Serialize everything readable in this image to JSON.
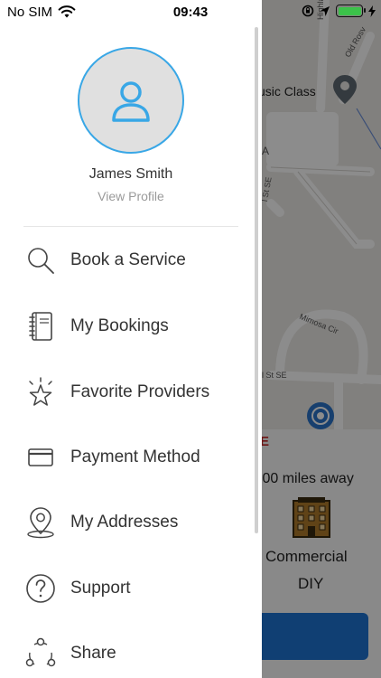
{
  "status_bar": {
    "carrier": "No SIM",
    "time": "09:43"
  },
  "profile": {
    "name": "James Smith",
    "link": "View Profile"
  },
  "menu": {
    "items": [
      {
        "label": "Book a Service",
        "icon": "search-icon"
      },
      {
        "label": "My Bookings",
        "icon": "notebook-icon"
      },
      {
        "label": "Favorite Providers",
        "icon": "star-icon"
      },
      {
        "label": "Payment Method",
        "icon": "card-icon"
      },
      {
        "label": "My Addresses",
        "icon": "location-pin-icon"
      },
      {
        "label": "Support",
        "icon": "question-icon"
      },
      {
        "label": "Share",
        "icon": "share-icon"
      }
    ]
  },
  "background": {
    "map_label_music": "usic Class",
    "map_street_1": "Highla",
    "map_street_2": "Old Rosv",
    "map_street_3": "Mimosa Cir",
    "map_street_4": "l St SE",
    "map_street_5": "ll St SE",
    "map_street_6": "A",
    "accent_letter": "E",
    "distance": ".00 miles away",
    "provider_type": "Commercial",
    "provider_subtype": "DIY"
  },
  "colors": {
    "accent": "#39a7e6",
    "button_blue": "#1e73d2",
    "battery_green": "#3cc24a"
  }
}
